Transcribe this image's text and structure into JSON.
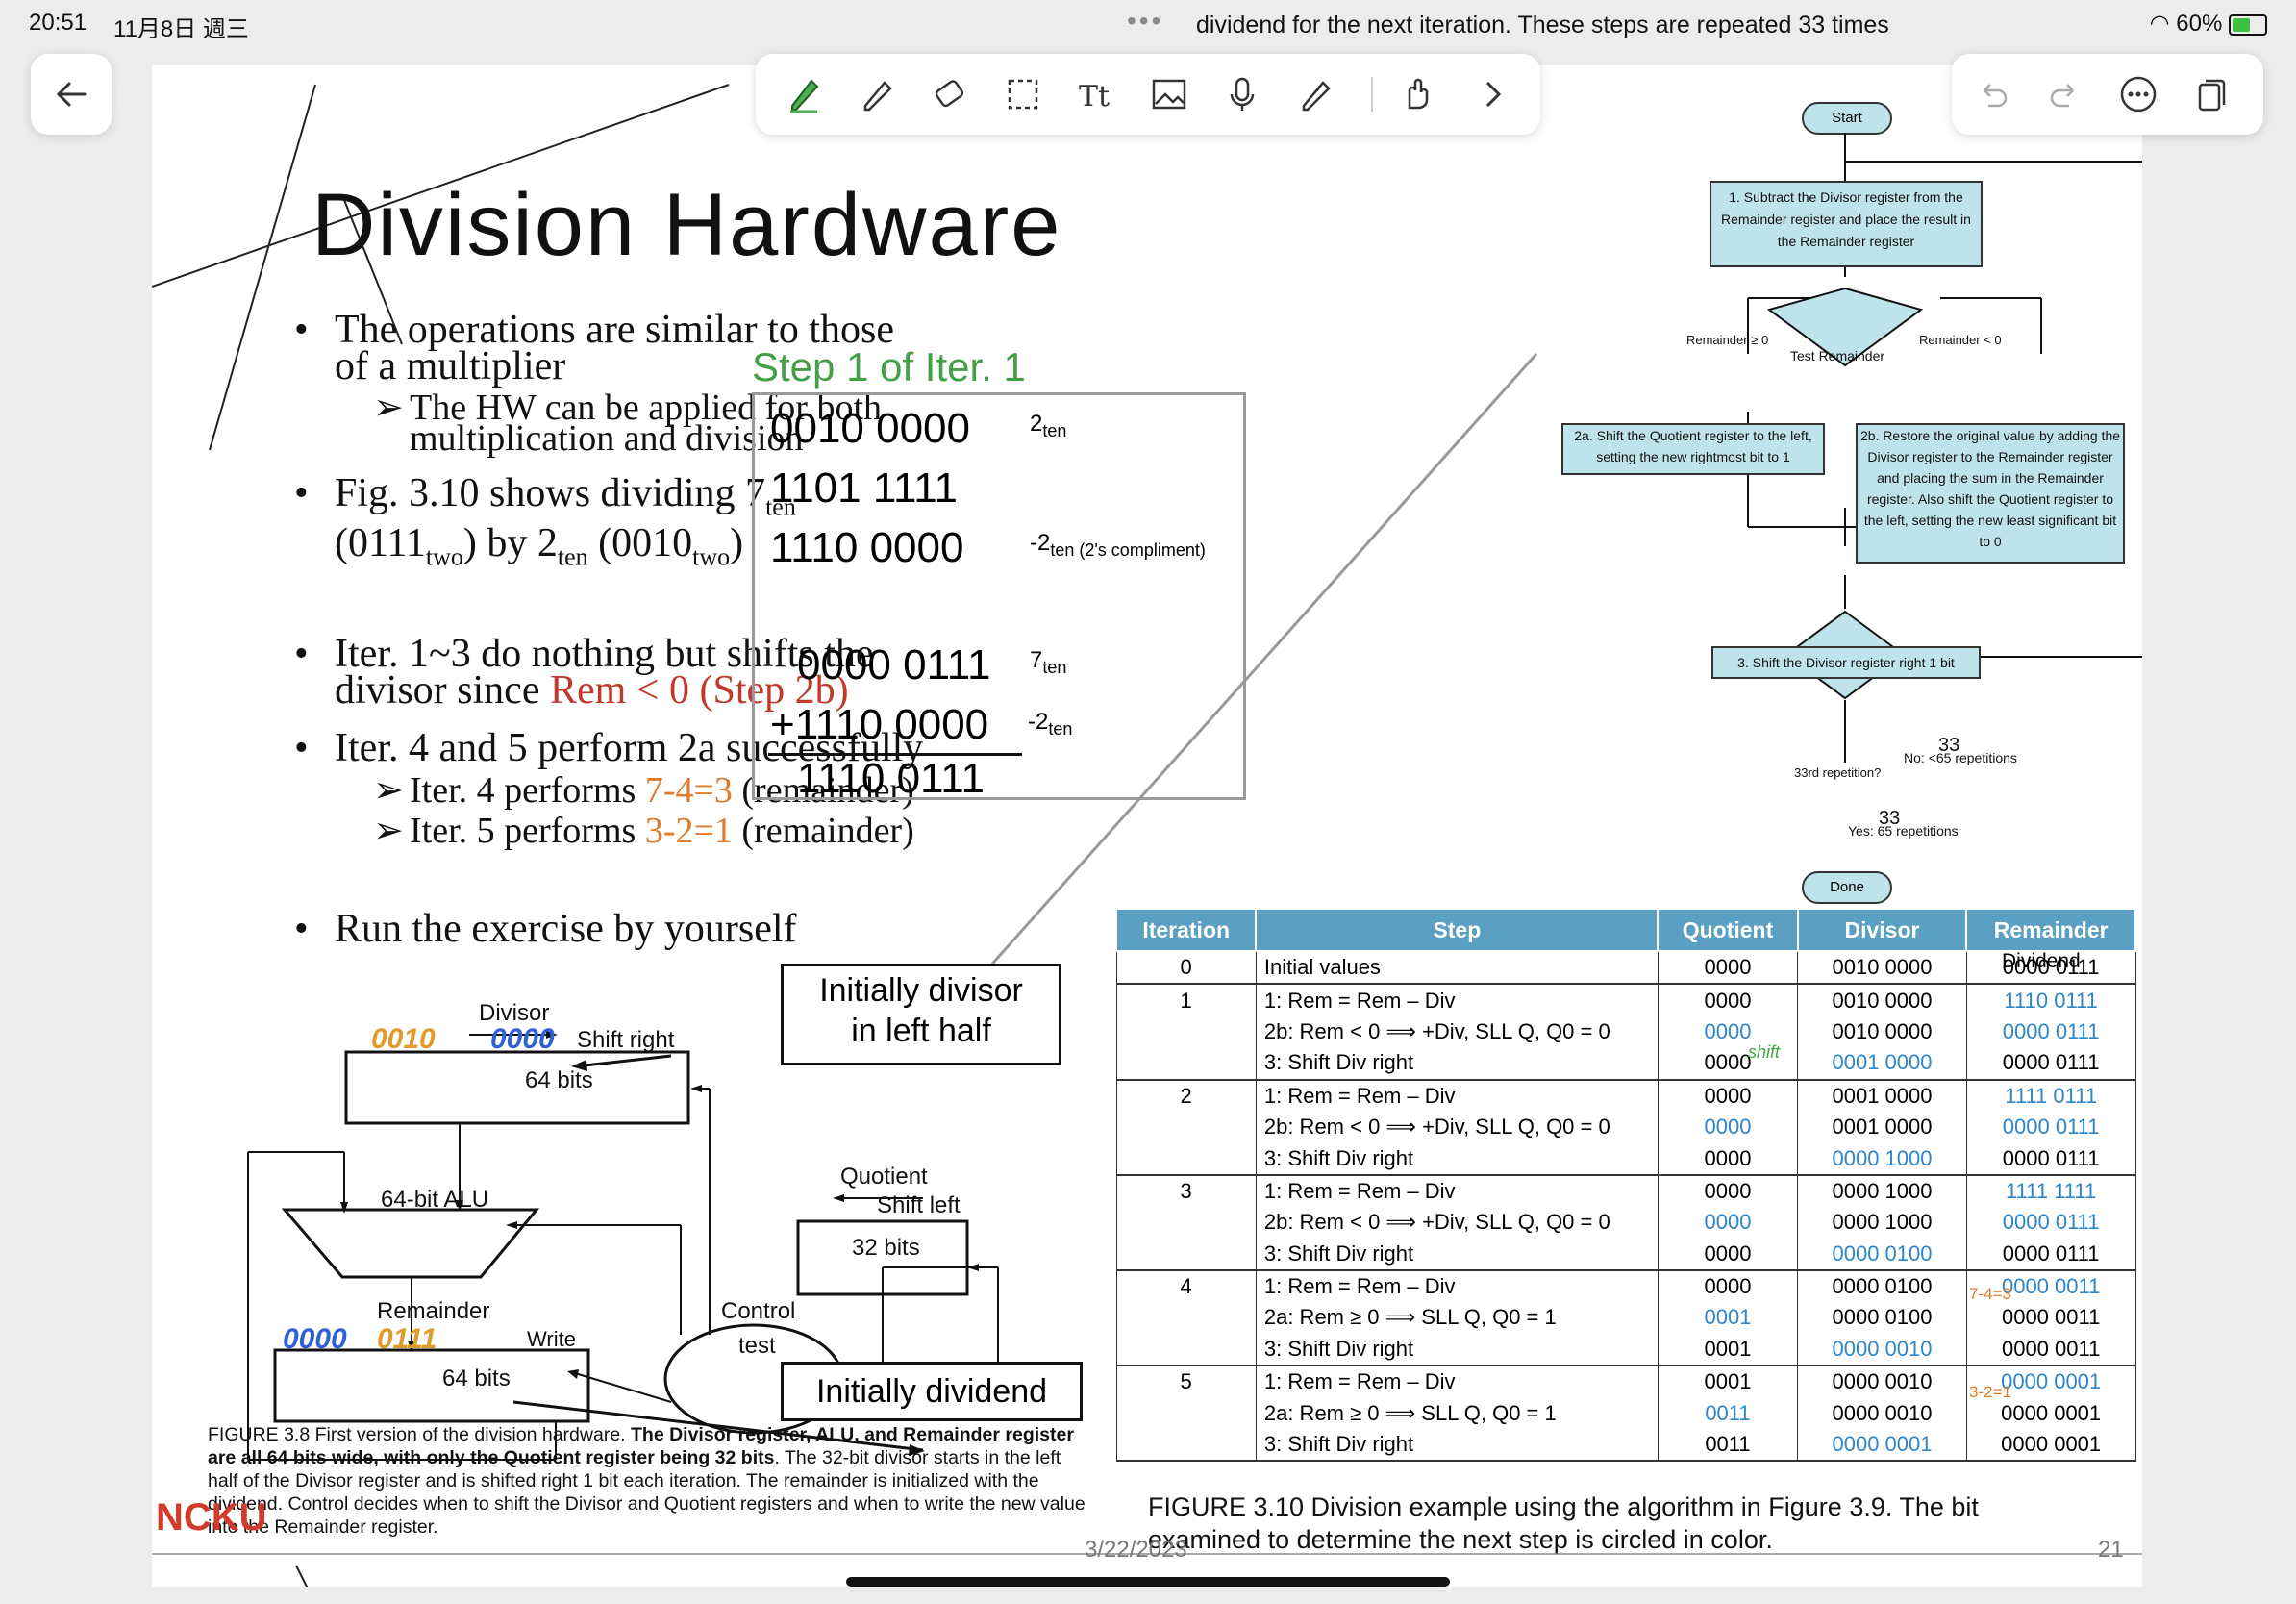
{
  "status_bar": {
    "time": "20:51",
    "date": "11月8日 週三",
    "battery": "60%",
    "top_center_text": "dividend for the next iteration. These steps are repeated 33 times"
  },
  "slide": {
    "title": "Division Hardware",
    "bullets": {
      "b1_line1": "The operations are similar to those",
      "b1_line2": "of a multiplier",
      "b1_sub1": "The HW can be applied for both",
      "b1_sub2": "multiplication and division",
      "b2_a": "Fig. 3.10 shows dividing 7",
      "b2_ten": "ten",
      "b2_b": "(0111",
      "b2_two": "two",
      "b2_c": ") by 2",
      "b2_ten2": "ten",
      "b2_d": " (0010",
      "b2_two2": "two",
      "b2_e": ")",
      "b3_line1": "Iter. 1~3 do nothing but shifts the",
      "b3_line2a": "divisor since ",
      "b3_line2b": "Rem < 0 (Step 2b)",
      "b4_line1": "Iter. 4 and 5 perform 2a successfully",
      "b4_sub1a": "Iter. 4 performs ",
      "b4_sub1b": "7-4=3",
      "b4_sub1c": " (remainder)",
      "b4_sub2a": "Iter. 5 performs ",
      "b4_sub2b": "3-2=1",
      "b4_sub2c": " (remainder)",
      "b5": "Run the exercise by yourself"
    },
    "step_box": {
      "heading": "Step 1 of Iter. 1",
      "row1": "0010 0000",
      "row1_note_a": "2",
      "row1_note_b": "ten",
      "row2": "1101 1111",
      "row3": "1110 0000",
      "row3_note_a": "-2",
      "row3_note_b": "ten (2's compliment)",
      "row4": "0000 0111",
      "row4_note_a": "7",
      "row4_note_b": "ten",
      "row5": "+1110 0000",
      "row5_note_a": "-2",
      "row5_note_b": "ten",
      "row6": "1110 0111"
    },
    "flowchart": {
      "start": "Start",
      "step1": "1. Subtract the Divisor register from the Remainder register and place the result in the Remainder register",
      "test": "Test Remainder",
      "ge": "Remainder ≥ 0",
      "lt": "Remainder < 0",
      "step2a": "2a. Shift the Quotient register to the left, setting the new rightmost bit to 1",
      "step2b": "2b. Restore the original value by adding the Divisor register to the Remainder register and placing the sum in the Remainder register. Also shift the Quotient register to the left, setting the new least significant bit to 0",
      "step3": "3. Shift the Divisor register right 1 bit",
      "rep": "33rd repetition?",
      "no": "No: <65 repetitions",
      "yes": "Yes: 65 repetitions",
      "hand33a": "33",
      "hand33b": "33",
      "done": "Done"
    },
    "hardware": {
      "divisor": "Divisor",
      "shift_right": "Shift right",
      "bits64a": "64 bits",
      "alu": "64-bit ALU",
      "quotient": "Quotient",
      "shift_left": "Shift left",
      "bits32": "32 bits",
      "remainder": "Remainder",
      "write": "Write",
      "bits64b": "64 bits",
      "control": "Control",
      "test": "test",
      "callout1_a": "Initially divisor",
      "callout1_b": "in left half",
      "callout2": "Initially dividend",
      "hand_div_a": "0010",
      "hand_div_b": "0000",
      "hand_rem_a": "0000",
      "hand_rem_b": "0111"
    },
    "fig38_caption": {
      "a": "FIGURE 3.8 First version of the division hardware. ",
      "b": "The Divisor register, ALU, and Remainder register are all 64 bits wide, with only the Quotient register being 32 bits",
      "c": ". The 32-bit divisor starts in the left half of the Divisor register and is shifted right 1 bit each iteration. The remainder is initialized with the dividend. Control decides when to shift the Divisor and Quotient registers and when to write the new value into the Remainder register."
    },
    "table": {
      "headers": [
        "Iteration",
        "Step",
        "Quotient",
        "Divisor",
        "Remainder"
      ],
      "dividend_label": "Dividend",
      "rows": [
        {
          "it": "0",
          "step": "Initial values",
          "q": "0000",
          "d": "0010 0000",
          "r": "0000 0111"
        },
        {
          "it": "1",
          "step": "1:  Rem = Rem – Div",
          "q": "0000",
          "d": "0010 0000",
          "r": "1110 0111"
        },
        {
          "it": "",
          "step": "2b: Rem < 0  ⟹  +Div, SLL Q, Q0 = 0",
          "q": "0000",
          "d": "0010 0000",
          "r": "0000 0111"
        },
        {
          "it": "",
          "step": "3:  Shift Div right",
          "q": "0000",
          "d": "0001 0000",
          "r": "0000 0111"
        },
        {
          "it": "2",
          "step": "1:  Rem = Rem – Div",
          "q": "0000",
          "d": "0001 0000",
          "r": "1111 0111"
        },
        {
          "it": "",
          "step": "2b: Rem < 0  ⟹  +Div, SLL Q, Q0 = 0",
          "q": "0000",
          "d": "0001 0000",
          "r": "0000 0111"
        },
        {
          "it": "",
          "step": "3:  Shift Div right",
          "q": "0000",
          "d": "0000 1000",
          "r": "0000 0111"
        },
        {
          "it": "3",
          "step": "1:  Rem = Rem – Div",
          "q": "0000",
          "d": "0000 1000",
          "r": "1111 1111"
        },
        {
          "it": "",
          "step": "2b: Rem < 0  ⟹  +Div, SLL Q, Q0 = 0",
          "q": "0000",
          "d": "0000 1000",
          "r": "0000 0111"
        },
        {
          "it": "",
          "step": "3:  Shift Div right",
          "q": "0000",
          "d": "0000 0100",
          "r": "0000 0111"
        },
        {
          "it": "4",
          "step": "1:  Rem = Rem – Div",
          "q": "0000",
          "d": "0000 0100",
          "r": "0000 0011"
        },
        {
          "it": "",
          "step": "2a: Rem ≥ 0  ⟹  SLL Q, Q0 = 1",
          "q": "0001",
          "d": "0000 0100",
          "r": "0000 0011"
        },
        {
          "it": "",
          "step": "3:  Shift Div right",
          "q": "0001",
          "d": "0000 0010",
          "r": "0000 0011"
        },
        {
          "it": "5",
          "step": "1:  Rem = Rem – Div",
          "q": "0001",
          "d": "0000 0010",
          "r": "0000 0001"
        },
        {
          "it": "",
          "step": "2a: Rem ≥ 0  ⟹  SLL Q, Q0 = 1",
          "q": "0011",
          "d": "0000 0010",
          "r": "0000 0001"
        },
        {
          "it": "",
          "step": "3:  Shift Div right",
          "q": "0011",
          "d": "0000 0001",
          "r": "0000 0001"
        }
      ],
      "hand_shift": "shift",
      "hand_743": "7-4=3",
      "hand_321": "3-2=1"
    },
    "fig310_caption_line1": "FIGURE 3.10 Division example using the algorithm in Figure 3.9. The bit",
    "fig310_caption_line2": "examined to determine the next step is circled in color.",
    "footer_date": "3/22/2023",
    "page_number": "21",
    "logo_text": "NCKU"
  },
  "colors": {
    "table_header": "#5b9fc2",
    "flow_fill": "#bfe3ea",
    "step_green": "#43a047",
    "accent_red": "#c0392b",
    "accent_orange": "#e07b2a",
    "value_blue": "#2e86c8"
  },
  "toolbar": {
    "tools": [
      "pen-icon",
      "highlighter-icon",
      "eraser-icon",
      "lasso-icon",
      "text-icon",
      "image-icon",
      "mic-icon",
      "laser-icon",
      "hand-icon",
      "chevron-right-icon"
    ],
    "actions": [
      "undo-icon",
      "redo-icon",
      "more-icon",
      "pages-icon"
    ]
  }
}
